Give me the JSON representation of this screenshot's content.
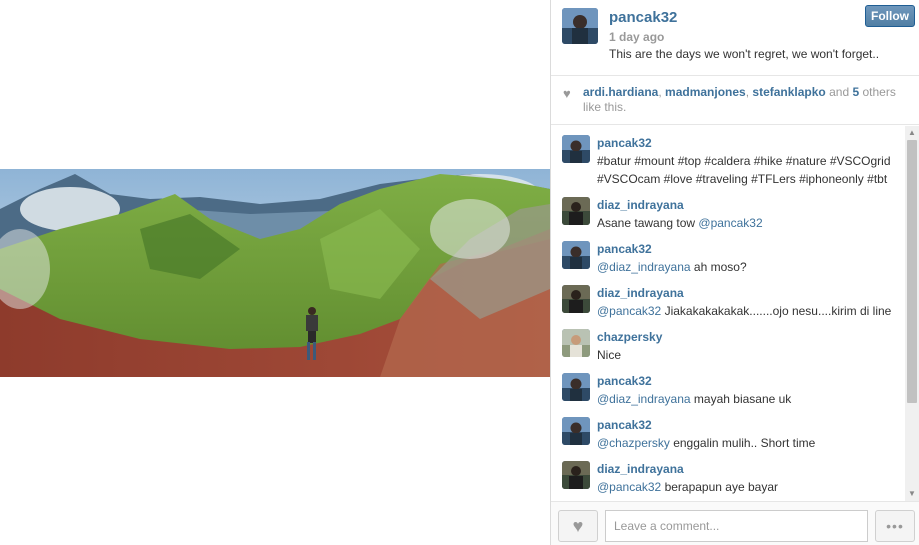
{
  "post": {
    "username": "pancak32",
    "time_ago": "1 day ago",
    "caption": "This are the days we won't regret, we won't forget..",
    "follow_label": "Follow"
  },
  "likes": {
    "users": [
      "ardi.hardiana",
      "madmanjones",
      "stefanklapko"
    ],
    "sep1": ", ",
    "sep2": ", ",
    "and_text": " and ",
    "others_count": "5",
    "others_text": " others like this."
  },
  "comments": [
    {
      "user": "pancak32",
      "mention": "",
      "text": "#batur #mount #top #caldera #hike #nature #VSCOgrid #VSCOcam #love #traveling #TFLers #iphoneonly #tbt",
      "avatar": "pancak"
    },
    {
      "user": "diaz_indrayana",
      "mention": "",
      "pre": "Asane tawang tow ",
      "mention2": "@pancak32",
      "avatar": "diaz"
    },
    {
      "user": "pancak32",
      "mention": "@diaz_indrayana",
      "text": " ah moso?",
      "avatar": "pancak"
    },
    {
      "user": "diaz_indrayana",
      "mention": "@pancak32",
      "text": " Jiakakakakakak.......ojo nesu....kirim di line",
      "avatar": "diaz"
    },
    {
      "user": "chazpersky",
      "mention": "",
      "text": "Nice",
      "avatar": "chaz"
    },
    {
      "user": "pancak32",
      "mention": "@diaz_indrayana",
      "text": " mayah biasane uk",
      "avatar": "pancak"
    },
    {
      "user": "pancak32",
      "mention": "@chazpersky",
      "text": " enggalin mulih.. Short time",
      "avatar": "pancak"
    },
    {
      "user": "diaz_indrayana",
      "mention": "@pancak32",
      "text": " berapapun aye bayar",
      "avatar": "diaz"
    }
  ],
  "footer": {
    "comment_placeholder": "Leave a comment...",
    "more_label": "•••"
  },
  "icons": {
    "like": "heart-icon",
    "more": "ellipsis-icon",
    "likes_heart": "heart-icon"
  },
  "colors": {
    "link": "#3f729b",
    "follow_bg": "#517fa4",
    "muted": "#999999"
  }
}
